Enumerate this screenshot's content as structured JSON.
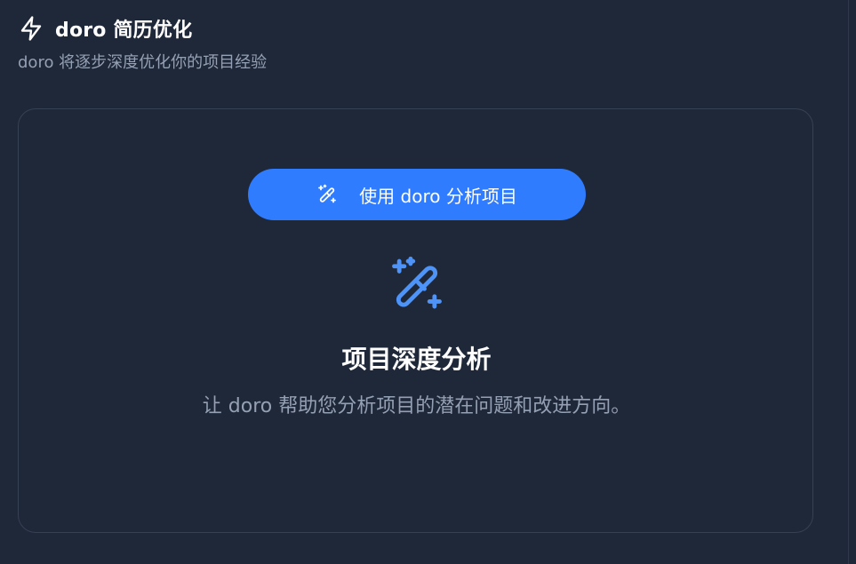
{
  "header": {
    "title": "doro 简历优化",
    "subtitle": "doro 将逐步深度优化你的项目经验",
    "icon": "lightning-icon"
  },
  "card": {
    "button_label": "使用 doro 分析项目",
    "button_icon": "magic-wand-icon",
    "hero_icon": "magic-wand-icon",
    "hero_title": "项目深度分析",
    "hero_description": "让 doro 帮助您分析项目的潜在问题和改进方向。"
  },
  "colors": {
    "background": "#1f2839",
    "accent": "#2f7cff",
    "icon_accent": "#4e93f7",
    "muted_text": "#94a0b3",
    "card_border": "#364154"
  }
}
